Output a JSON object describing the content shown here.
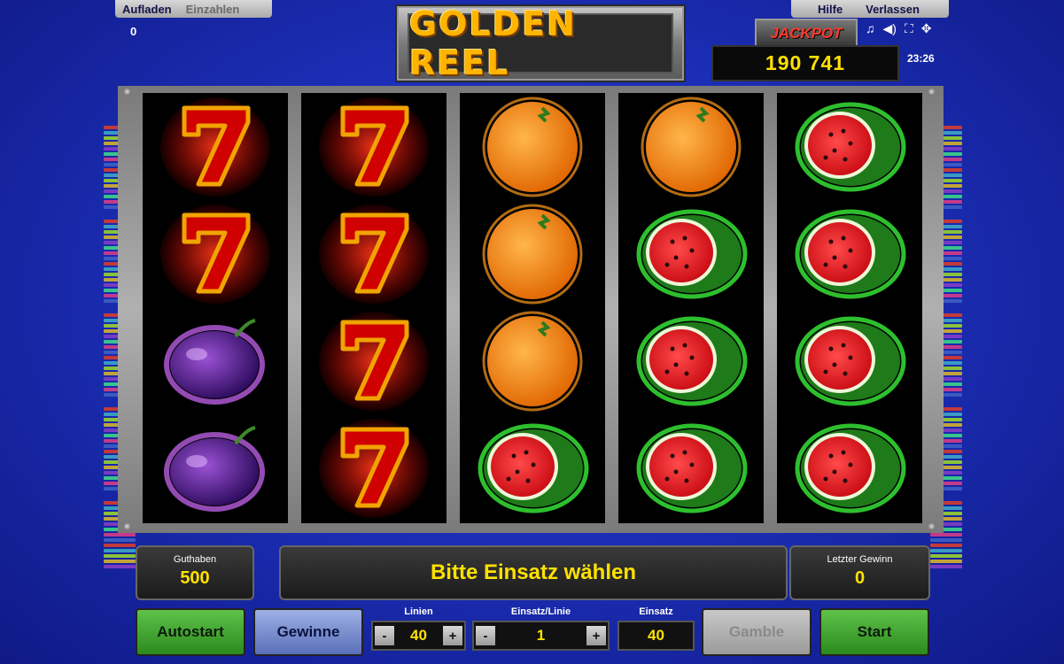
{
  "top_left": {
    "aufladen": "Aufladen",
    "einzahlen": "Einzahlen",
    "credit": "0"
  },
  "top_right": {
    "hilfe": "Hilfe",
    "verlassen": "Verlassen",
    "time": "23:26"
  },
  "logo": {
    "text": "GOLDEN REEL"
  },
  "jackpot": {
    "label": "JACKPOT",
    "value": "190 741"
  },
  "reels": [
    [
      "seven",
      "seven",
      "plum",
      "plum"
    ],
    [
      "seven",
      "seven",
      "seven",
      "seven"
    ],
    [
      "orange",
      "orange",
      "orange",
      "watermelon"
    ],
    [
      "orange",
      "watermelon",
      "watermelon",
      "watermelon"
    ],
    [
      "watermelon",
      "watermelon",
      "watermelon",
      "watermelon"
    ]
  ],
  "balance": {
    "label": "Guthaben",
    "value": "500"
  },
  "message": "Bitte Einsatz wählen",
  "last_win": {
    "label": "Letzter Gewinn",
    "value": "0"
  },
  "buttons": {
    "autostart": "Autostart",
    "gewinne": "Gewinne",
    "gamble": "Gamble",
    "start": "Start"
  },
  "lines": {
    "label": "Linien",
    "value": "40",
    "minus": "-",
    "plus": "+"
  },
  "bet_per_line": {
    "label": "Einsatz/Linie",
    "value": "1",
    "minus": "-",
    "plus": "+"
  },
  "total_bet": {
    "label": "Einsatz",
    "value": "40"
  },
  "colors": {
    "accent_yellow": "#ffe100",
    "start_green": "#2b8a1e",
    "background_blue": "#1c2fb8"
  },
  "icons": [
    "music-icon",
    "sound-icon",
    "fullscreen-icon",
    "settings-icon"
  ]
}
